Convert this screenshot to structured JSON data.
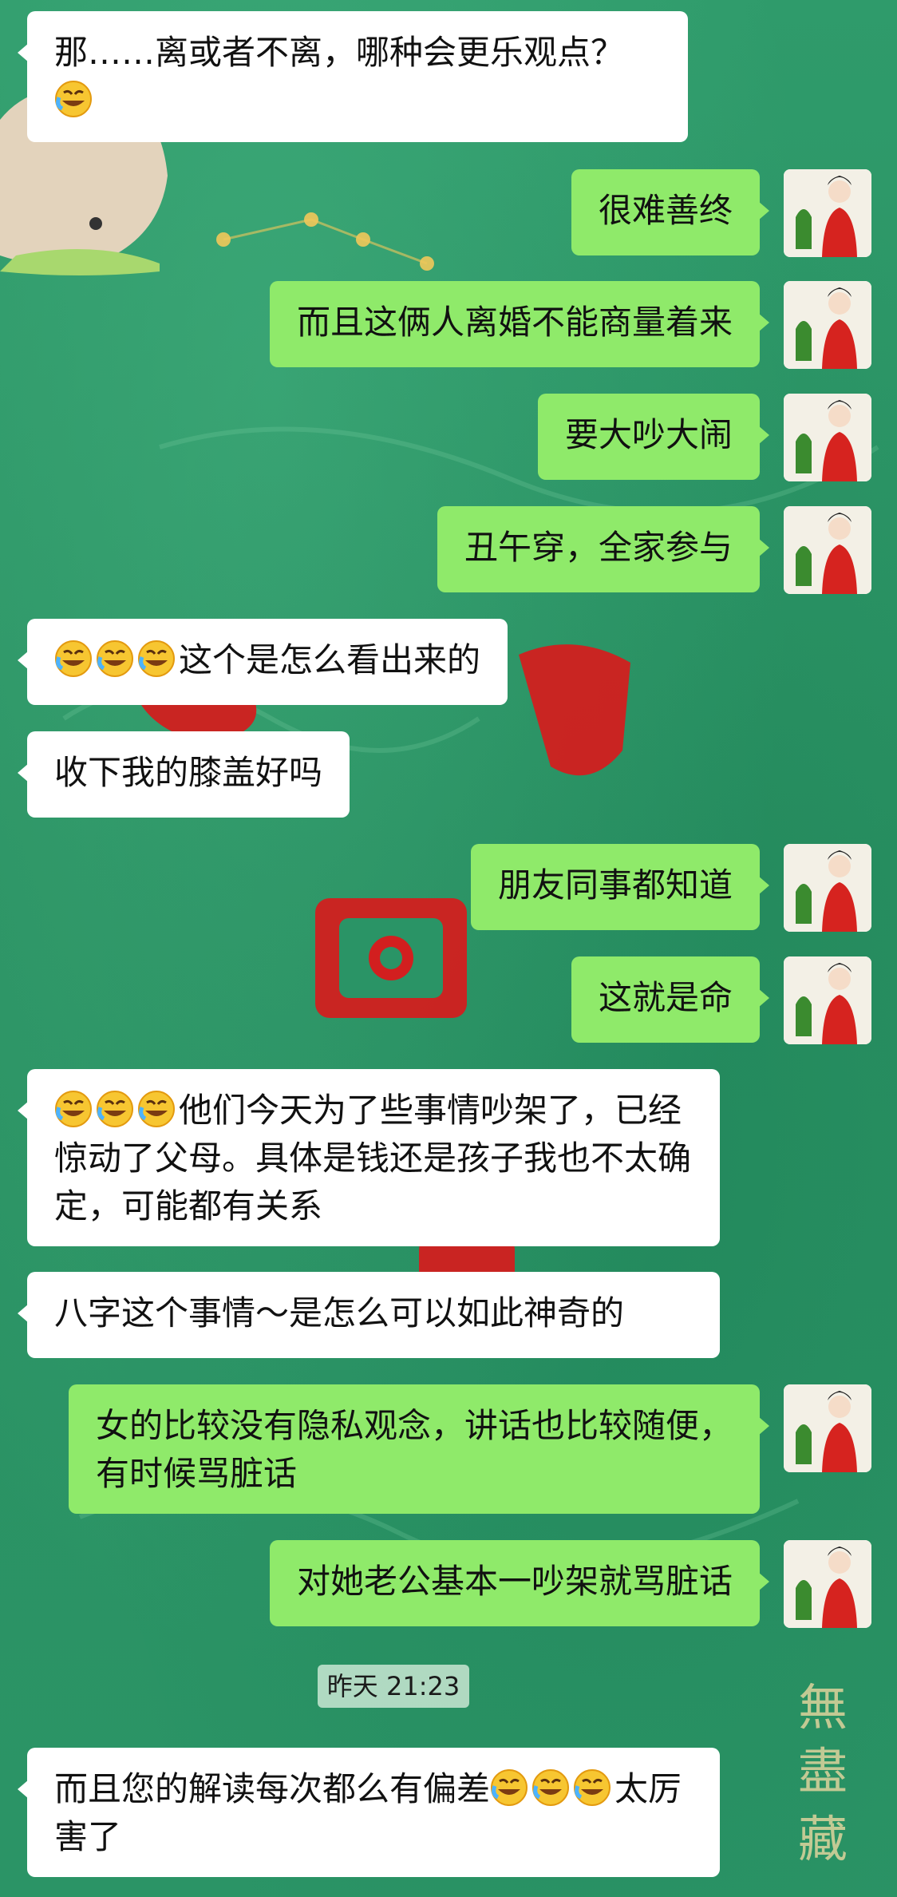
{
  "chat": {
    "timestamp": "昨天 21:23",
    "messages": [
      {
        "id": "m1",
        "side": "incoming",
        "text": "那……离或者不离，哪种会更乐观点？",
        "emoji_suffix": 1
      },
      {
        "id": "m2",
        "side": "outgoing",
        "text": "很难善终"
      },
      {
        "id": "m3",
        "side": "outgoing",
        "text": "而且这俩人离婚不能商量着来"
      },
      {
        "id": "m4",
        "side": "outgoing",
        "text": "要大吵大闹"
      },
      {
        "id": "m5",
        "side": "outgoing",
        "text": "丑午穿，全家参与"
      },
      {
        "id": "m6",
        "side": "incoming",
        "text": "这个是怎么看出来的",
        "emoji_prefix": 3
      },
      {
        "id": "m7",
        "side": "incoming",
        "text": "收下我的膝盖好吗"
      },
      {
        "id": "m8",
        "side": "outgoing",
        "text": "朋友同事都知道"
      },
      {
        "id": "m9",
        "side": "outgoing",
        "text": "这就是命"
      },
      {
        "id": "m10",
        "side": "incoming",
        "text": "他们今天为了些事情吵架了，已经惊动了父母。具体是钱还是孩子我也不太确定，可能都有关系",
        "emoji_prefix": 3
      },
      {
        "id": "m11",
        "side": "incoming",
        "text": "八字这个事情～是怎么可以如此神奇的"
      },
      {
        "id": "m12",
        "side": "outgoing",
        "text": "女的比较没有隐私观念，讲话也比较随便，有时候骂脏话"
      },
      {
        "id": "m13",
        "side": "outgoing",
        "text": "对她老公基本一吵架就骂脏话"
      },
      {
        "id": "m14",
        "side": "incoming",
        "text_before": "而且您的解读每次都么有偏差",
        "text_after": "太厉害了",
        "emoji_middle": 3
      }
    ]
  },
  "icons": {
    "emoji": "laughing-crying-emoji-icon",
    "avatar": "avatar-woman-red-dress-icon"
  },
  "colors": {
    "background": "#2a9466",
    "incoming_bubble": "#ffffff",
    "outgoing_bubble": "#8fea6a",
    "decor_red": "#d21f1f"
  }
}
